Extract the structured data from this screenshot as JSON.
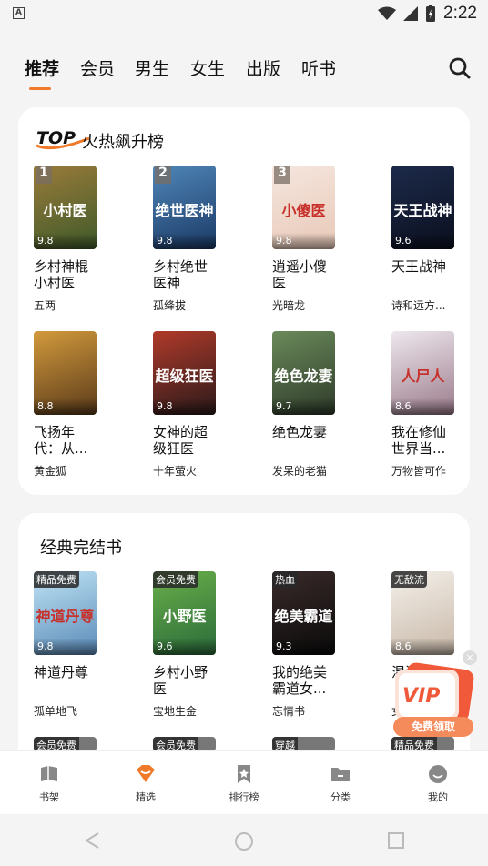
{
  "status": {
    "time": "2:22"
  },
  "tabs": [
    {
      "label": "推荐",
      "active": true
    },
    {
      "label": "会员",
      "active": false
    },
    {
      "label": "男生",
      "active": false
    },
    {
      "label": "女生",
      "active": false
    },
    {
      "label": "出版",
      "active": false
    },
    {
      "label": "听书",
      "active": false
    }
  ],
  "hot": {
    "logo": "TOP",
    "title": "火热飙升榜",
    "books": [
      {
        "rank": "1",
        "score": "9.8",
        "title": "乡村神棍小村医",
        "author": "五两",
        "cover_text": "小村医",
        "c1": "#9a7b3a",
        "c2": "#3f5a2a"
      },
      {
        "rank": "2",
        "score": "9.8",
        "title": "乡村绝世医神",
        "author": "孤绛拔",
        "cover_text": "绝世医神",
        "c1": "#4f86b8",
        "c2": "#1b3a66"
      },
      {
        "rank": "3",
        "score": "9.8",
        "title": "逍遥小傻医",
        "author": "光暗龙",
        "cover_text": "小傻医",
        "c1": "#f5e6de",
        "c2": "#e8c9b8"
      },
      {
        "rank": "",
        "score": "9.6",
        "title": "天王战神",
        "author": "诗和远方...",
        "cover_text": "天王战神",
        "c1": "#1c2a4a",
        "c2": "#0b0f1e"
      },
      {
        "rank": "",
        "score": "8.8",
        "title": "飞扬年代：从...",
        "author": "黄金狐",
        "cover_text": "",
        "c1": "#d29a3c",
        "c2": "#5a3a1a"
      },
      {
        "rank": "",
        "score": "9.8",
        "title": "女神的超级狂医",
        "author": "十年萤火",
        "cover_text": "超级狂医",
        "c1": "#b03a2a",
        "c2": "#2a1a1a"
      },
      {
        "rank": "",
        "score": "9.7",
        "title": "绝色龙妻",
        "author": "发呆的老猫",
        "cover_text": "绝色龙妻",
        "c1": "#6a8a5a",
        "c2": "#2e3a2a"
      },
      {
        "rank": "",
        "score": "8.6",
        "title": "我在修仙世界当...",
        "author": "万物皆可作",
        "cover_text": "人尸人",
        "c1": "#eee8ee",
        "c2": "#9a7a8a"
      }
    ]
  },
  "classic": {
    "title": "经典完结书",
    "books": [
      {
        "tag": "精品免费",
        "score": "9.8",
        "title": "神道丹尊",
        "author": "孤单地飞",
        "cover_text": "神道丹尊",
        "c1": "#bfe4f4",
        "c2": "#5a8ab8"
      },
      {
        "tag": "会员免费",
        "score": "9.6",
        "title": "乡村小野医",
        "author": "宝地生金",
        "cover_text": "小野医",
        "c1": "#6ab04a",
        "c2": "#2a6a3a"
      },
      {
        "tag": "热血",
        "score": "9.3",
        "title": "我的绝美霸道女...",
        "author": "忘情书",
        "cover_text": "绝美霸道",
        "c1": "#3a2a2a",
        "c2": "#0a0a0a"
      },
      {
        "tag": "无敌流",
        "score": "8.6",
        "title": "混沌...",
        "author": "女...",
        "cover_text": "",
        "c1": "#f4f0ea",
        "c2": "#c8b8a8"
      }
    ],
    "peek_tags": [
      "会员免费",
      "会员免费",
      "穿越",
      "精品免费"
    ]
  },
  "vip": {
    "badge": "VIP",
    "button": "免费领取",
    "close": "×"
  },
  "nav": [
    {
      "label": "书架",
      "icon": "bookshelf-icon"
    },
    {
      "label": "精选",
      "icon": "featured-icon",
      "active": true
    },
    {
      "label": "排行榜",
      "icon": "ranking-icon"
    },
    {
      "label": "分类",
      "icon": "category-icon"
    },
    {
      "label": "我的",
      "icon": "profile-icon"
    }
  ],
  "colors": {
    "accent": "#f07a2a",
    "vip": "#f05a3a"
  }
}
